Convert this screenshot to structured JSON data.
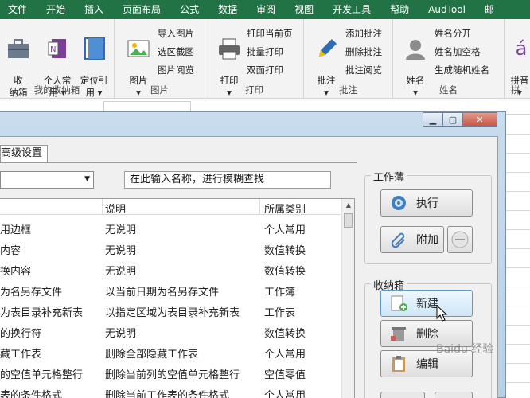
{
  "ribbon_tabs": [
    "文件",
    "开始",
    "插入",
    "页面布局",
    "公式",
    "数据",
    "审阅",
    "视图",
    "开发工具",
    "帮助",
    "AudTool",
    "邮"
  ],
  "ribbon": {
    "g1": {
      "label": "我的收纳箱",
      "b1": "收\n纳箱",
      "b2": "个人常\n用 ▾",
      "b3": "定位引\n用 ▾"
    },
    "g2": {
      "label": "图片",
      "big": "图片\n▾",
      "s1": "导入图片",
      "s2": "选区截图",
      "s3": "图片阅览"
    },
    "g3": {
      "label": "打印",
      "big": "打印\n▾",
      "s1": "打印当前页",
      "s2": "批量打印",
      "s3": "双面打印"
    },
    "g4": {
      "label": "批注",
      "big": "批注\n▾",
      "s1": "添加批注",
      "s2": "删除批注",
      "s3": "批注阅览"
    },
    "g5": {
      "label": "姓名",
      "big": "姓名\n▾",
      "s1": "姓名分开",
      "s2": "姓名加空格",
      "s3": "生成随机姓名"
    },
    "g6": {
      "label": "拼",
      "big": "拼音\n▾",
      "big_icon_text": "á"
    }
  },
  "dialog": {
    "tab_label": "高级设置",
    "search_placeholder": "在此输入名称，进行模糊查找",
    "columns": [
      "说明",
      "所属类别"
    ],
    "rows": [
      [
        "用边框",
        "无说明",
        "个人常用"
      ],
      [
        "内容",
        "无说明",
        "数值转换"
      ],
      [
        "换内容",
        "无说明",
        "数值转换"
      ],
      [
        "为名另存文件",
        "以当前日期为名另存文件",
        "工作簿"
      ],
      [
        "为表目录补充新表",
        "以指定区域为表目录补充新表",
        "工作表"
      ],
      [
        "的换行符",
        "无说明",
        "数值转换"
      ],
      [
        "藏工作表",
        "删除全部隐藏工作表",
        "个人常用"
      ],
      [
        "的空值单元格整行",
        "删除当前列的空值单元格整行",
        "空值零值"
      ],
      [
        "表的条件格式",
        "删除当前工作表的条件格式",
        "个人常用"
      ]
    ],
    "workbook_group": "工作薄",
    "btn_execute": "执行",
    "btn_attach": "附加",
    "box_group": "收纳箱",
    "btn_new": "新建",
    "btn_delete": "删除",
    "btn_edit": "编辑"
  },
  "watermark": "Baidu 经验"
}
